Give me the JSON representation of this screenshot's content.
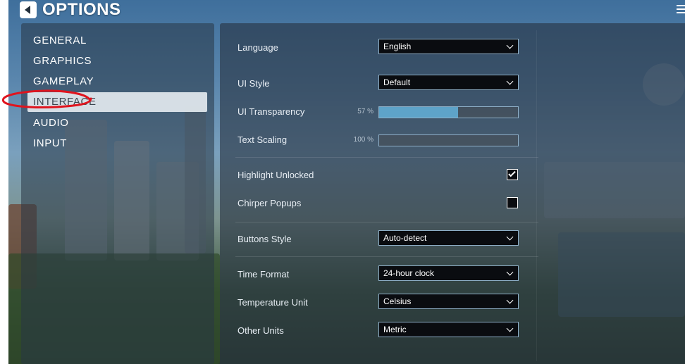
{
  "header": {
    "title": "OPTIONS"
  },
  "categories": [
    {
      "label": "GENERAL",
      "active": false
    },
    {
      "label": "GRAPHICS",
      "active": false
    },
    {
      "label": "GAMEPLAY",
      "active": false
    },
    {
      "label": "INTERFACE",
      "active": true
    },
    {
      "label": "AUDIO",
      "active": false
    },
    {
      "label": "INPUT",
      "active": false
    }
  ],
  "settings": {
    "language": {
      "label": "Language",
      "value": "English"
    },
    "ui_style": {
      "label": "UI Style",
      "value": "Default"
    },
    "ui_transparency": {
      "label": "UI Transparency",
      "value_text": "57 %",
      "value": 0.57
    },
    "text_scaling": {
      "label": "Text Scaling",
      "value_text": "100 %",
      "value": 0.0
    },
    "highlight_unlocked": {
      "label": "Highlight Unlocked",
      "checked": true
    },
    "chirper_popups": {
      "label": "Chirper Popups",
      "checked": false
    },
    "buttons_style": {
      "label": "Buttons Style",
      "value": "Auto-detect"
    },
    "time_format": {
      "label": "Time Format",
      "value": "24-hour clock"
    },
    "temperature_unit": {
      "label": "Temperature Unit",
      "value": "Celsius"
    },
    "other_units": {
      "label": "Other Units",
      "value": "Metric"
    }
  },
  "colors": {
    "accent_fill": "#5ea3c9",
    "annotation": "#e0141e",
    "active_item_bg": "#ebf0f5"
  },
  "icons": {
    "back": "back-arrow-icon",
    "menu": "menu-icon",
    "dropdown": "chevron-down-icon",
    "check": "checkmark-icon"
  }
}
